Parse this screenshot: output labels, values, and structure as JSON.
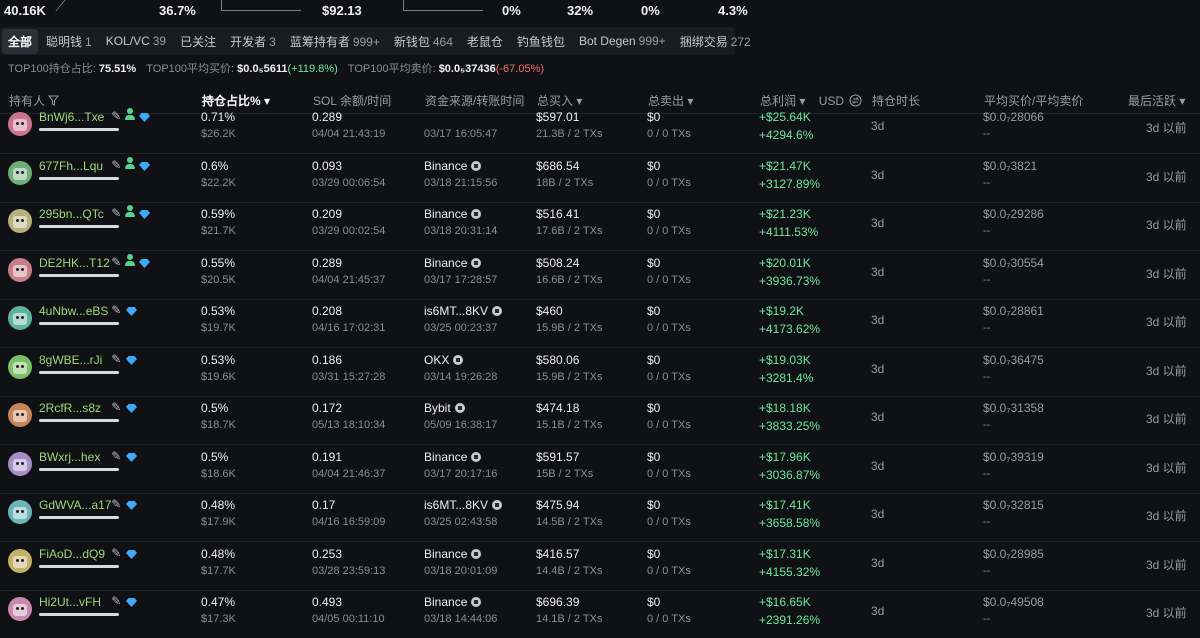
{
  "top_stats": {
    "values": [
      "40.16K",
      "36.7%",
      "$92.13",
      "0%",
      "32%",
      "0%",
      "4.3%"
    ]
  },
  "tabs": [
    {
      "label": "全部",
      "count": ""
    },
    {
      "label": "聪明钱",
      "count": "1"
    },
    {
      "label": "KOL/VC",
      "count": "39"
    },
    {
      "label": "已关注",
      "count": ""
    },
    {
      "label": "开发者",
      "count": "3"
    },
    {
      "label": "蓝筹持有者",
      "count": "999+"
    },
    {
      "label": "新钱包",
      "count": "464"
    },
    {
      "label": "老鼠仓",
      "count": ""
    },
    {
      "label": "钓鱼钱包",
      "count": ""
    },
    {
      "label": "Bot Degen",
      "count": "999+"
    },
    {
      "label": "捆绑交易",
      "count": "272"
    }
  ],
  "summary": {
    "top100_hold_label": "TOP100持仓占比:",
    "top100_hold_value": "75.51%",
    "top100_avg_buy_label": "TOP100平均买价:",
    "top100_avg_buy_value": "$0.0₅5611",
    "top100_avg_buy_change": "(+119.8%)",
    "top100_avg_sell_label": "TOP100平均卖价:",
    "top100_avg_sell_value": "$0.0₅37436",
    "top100_avg_sell_change": "(-67.05%)"
  },
  "columns": {
    "holder": "持有人",
    "share": "持仓占比% ▾",
    "sol": "SOL 余额/时间",
    "source": "资金来源/转账时间",
    "bought": "总买入 ▾",
    "sold": "总卖出 ▾",
    "profit": "总利润 ▾",
    "currency": "USD",
    "duration": "持仓时长",
    "avg_price": "平均买价/平均卖价",
    "last_active": "最后活跃 ▾"
  },
  "colors": {
    "accent_green": "#6ee7a0",
    "address_green": "#9cd97a",
    "negative_red": "#f26d6d",
    "diamond_blue": "#3fa9f5"
  },
  "rows": [
    {
      "addr": "BnWj6...Txe",
      "has_user_icon": true,
      "pct": "0.71%",
      "value": "$26.2K",
      "sol": "0.289",
      "sol_time": "04/04 21:43:19",
      "source": "",
      "source_time": "03/17 16:05:47",
      "buy": "$597.01",
      "buy_sub": "21.3B / 2 TXs",
      "sell": "$0",
      "sell_sub": "0 / 0 TXs",
      "profit": "+$25.64K",
      "profit_pct": "+4294.6%",
      "duration": "3d",
      "avg": "$0.0₇28066",
      "avg_sell": "--",
      "last": "3d 以前",
      "avatar": "#c9738f"
    },
    {
      "addr": "677Fh...Lqu",
      "has_user_icon": true,
      "pct": "0.6%",
      "value": "$22.2K",
      "sol": "0.093",
      "sol_time": "03/29 00:06:54",
      "source": "Binance",
      "source_time": "03/18 21:15:56",
      "buy": "$686.54",
      "buy_sub": "18B / 2 TXs",
      "sell": "$0",
      "sell_sub": "0 / 0 TXs",
      "profit": "+$21.47K",
      "profit_pct": "+3127.89%",
      "duration": "3d",
      "avg": "$0.0₇3821",
      "avg_sell": "--",
      "last": "3d 以前",
      "avatar": "#6fae7b"
    },
    {
      "addr": "295bn...QTc",
      "has_user_icon": true,
      "pct": "0.59%",
      "value": "$21.7K",
      "sol": "0.209",
      "sol_time": "03/29 00:02:54",
      "source": "Binance",
      "source_time": "03/18 20:31:14",
      "buy": "$516.41",
      "buy_sub": "17.6B / 2 TXs",
      "sell": "$0",
      "sell_sub": "0 / 0 TXs",
      "profit": "+$21.23K",
      "profit_pct": "+4111.53%",
      "duration": "3d",
      "avg": "$0.0₇29286",
      "avg_sell": "--",
      "last": "3d 以前",
      "avatar": "#b8b07a"
    },
    {
      "addr": "DE2HK...T12",
      "has_user_icon": true,
      "pct": "0.55%",
      "value": "$20.5K",
      "sol": "0.289",
      "sol_time": "04/04 21:45:37",
      "source": "Binance",
      "source_time": "03/17 17:28:57",
      "buy": "$508.24",
      "buy_sub": "16.6B / 2 TXs",
      "sell": "$0",
      "sell_sub": "0 / 0 TXs",
      "profit": "+$20.01K",
      "profit_pct": "+3936.73%",
      "duration": "3d",
      "avg": "$0.0₇30554",
      "avg_sell": "--",
      "last": "3d 以前",
      "avatar": "#c97f8a"
    },
    {
      "addr": "4uNbw...eBS",
      "has_user_icon": false,
      "pct": "0.53%",
      "value": "$19.7K",
      "sol": "0.208",
      "sol_time": "04/16 17:02:31",
      "source": "is6MT...8KV",
      "source_time": "03/25 00:23:37",
      "buy": "$460",
      "buy_sub": "15.9B / 2 TXs",
      "sell": "$0",
      "sell_sub": "0 / 0 TXs",
      "profit": "+$19.2K",
      "profit_pct": "+4173.62%",
      "duration": "3d",
      "avg": "$0.0₇28861",
      "avg_sell": "--",
      "last": "3d 以前",
      "avatar": "#5fb39c"
    },
    {
      "addr": "8gWBE...rJi",
      "has_user_icon": false,
      "pct": "0.53%",
      "value": "$19.6K",
      "sol": "0.186",
      "sol_time": "03/31 15:27:28",
      "source": "OKX",
      "source_time": "03/14 19:26:28",
      "buy": "$580.06",
      "buy_sub": "15.9B / 2 TXs",
      "sell": "$0",
      "sell_sub": "0 / 0 TXs",
      "profit": "+$19.03K",
      "profit_pct": "+3281.4%",
      "duration": "3d",
      "avg": "$0.0₇36475",
      "avg_sell": "--",
      "last": "3d 以前",
      "avatar": "#7bbf6a"
    },
    {
      "addr": "2RcfR...s8z",
      "has_user_icon": false,
      "pct": "0.5%",
      "value": "$18.7K",
      "sol": "0.172",
      "sol_time": "05/13 18:10:34",
      "source": "Bybit",
      "source_time": "05/09 16:38:17",
      "buy": "$474.18",
      "buy_sub": "15.1B / 2 TXs",
      "sell": "$0",
      "sell_sub": "0 / 0 TXs",
      "profit": "+$18.18K",
      "profit_pct": "+3833.25%",
      "duration": "3d",
      "avg": "$0.0₇31358",
      "avg_sell": "--",
      "last": "3d 以前",
      "avatar": "#c7855a"
    },
    {
      "addr": "BWxrj...hex",
      "has_user_icon": false,
      "pct": "0.5%",
      "value": "$18.6K",
      "sol": "0.191",
      "sol_time": "04/04 21:46:37",
      "source": "Binance",
      "source_time": "03/17 20:17:16",
      "buy": "$591.57",
      "buy_sub": "15B / 2 TXs",
      "sell": "$0",
      "sell_sub": "0 / 0 TXs",
      "profit": "+$17.96K",
      "profit_pct": "+3036.87%",
      "duration": "3d",
      "avg": "$0.0₇39319",
      "avg_sell": "--",
      "last": "3d 以前",
      "avatar": "#a58fc7"
    },
    {
      "addr": "GdWVA...a17",
      "has_user_icon": false,
      "pct": "0.48%",
      "value": "$17.9K",
      "sol": "0.17",
      "sol_time": "04/16 16:59:09",
      "source": "is6MT...8KV",
      "source_time": "03/25 02:43:58",
      "buy": "$475.94",
      "buy_sub": "14.5B / 2 TXs",
      "sell": "$0",
      "sell_sub": "0 / 0 TXs",
      "profit": "+$17.41K",
      "profit_pct": "+3658.58%",
      "duration": "3d",
      "avg": "$0.0₇32815",
      "avg_sell": "--",
      "last": "3d 以前",
      "avatar": "#6bb5b8"
    },
    {
      "addr": "FiAoD...dQ9",
      "has_user_icon": false,
      "pct": "0.48%",
      "value": "$17.7K",
      "sol": "0.253",
      "sol_time": "03/28 23:59:13",
      "source": "Binance",
      "source_time": "03/18 20:01:09",
      "buy": "$416.57",
      "buy_sub": "14.4B / 2 TXs",
      "sell": "$0",
      "sell_sub": "0 / 0 TXs",
      "profit": "+$17.31K",
      "profit_pct": "+4155.32%",
      "duration": "3d",
      "avg": "$0.0₇28985",
      "avg_sell": "--",
      "last": "3d 以前",
      "avatar": "#c2b26a"
    },
    {
      "addr": "Hi2Ut...vFH",
      "has_user_icon": false,
      "pct": "0.47%",
      "value": "$17.3K",
      "sol": "0.493",
      "sol_time": "04/05 00:11:10",
      "source": "Binance",
      "source_time": "03/18 14:44:06",
      "buy": "$696.39",
      "buy_sub": "14.1B / 2 TXs",
      "sell": "$0",
      "sell_sub": "0 / 0 TXs",
      "profit": "+$16.65K",
      "profit_pct": "+2391.26%",
      "duration": "3d",
      "avg": "$0.0₇49508",
      "avg_sell": "--",
      "last": "3d 以前",
      "avatar": "#c98ab0"
    }
  ]
}
